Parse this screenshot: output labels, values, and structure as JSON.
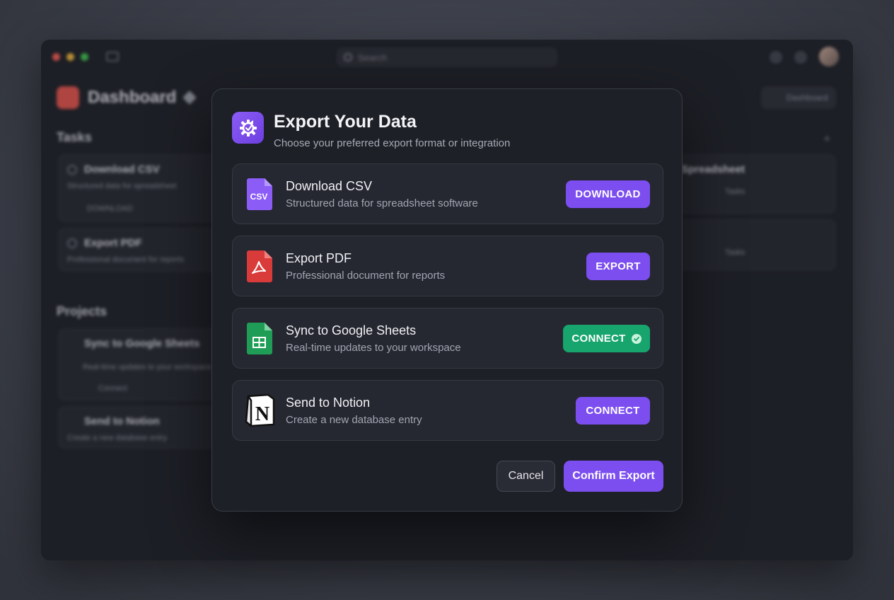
{
  "background": {
    "search_placeholder": "Search",
    "dashboard_title": "Dashboard",
    "tasks_heading": "Tasks",
    "projects_heading": "Projects",
    "header_pill_label": "Dashboard",
    "task_cards": [
      {
        "title": "Download CSV",
        "desc": "Structured data for spreadsheet",
        "meta": "DOWNLOAD"
      },
      {
        "title": "Export PDF",
        "desc": "Professional document for reports"
      }
    ],
    "project_cards": [
      {
        "title": "Sync to Google Sheets",
        "desc": "Real-time updates to your workspace",
        "meta": "Connect"
      },
      {
        "title": "Send to Notion",
        "desc": "Create a new database entry"
      }
    ],
    "right_cards": [
      {
        "title": "Spreadsheet",
        "meta": "Tasks"
      },
      {
        "title": "",
        "meta": "Tasks"
      }
    ]
  },
  "modal": {
    "title": "Export Your Data",
    "subtitle": "Choose your preferred export format or integration",
    "options": [
      {
        "title": "Download CSV",
        "desc": "Structured data for spreadsheet software",
        "button": "DOWNLOAD",
        "icon": "csv-file-icon",
        "icon_text": "CSV"
      },
      {
        "title": "Export PDF",
        "desc": "Professional document for reports",
        "button": "EXPORT",
        "icon": "pdf-file-icon"
      },
      {
        "title": "Sync to Google Sheets",
        "desc": "Real-time updates to your workspace",
        "button": "CONNECT",
        "icon": "google-sheets-icon",
        "connected": true
      },
      {
        "title": "Send to Notion",
        "desc": "Create a new database entry",
        "button": "CONNECT",
        "icon": "notion-icon",
        "icon_text": "N"
      }
    ],
    "cancel_label": "Cancel",
    "confirm_label": "Confirm Export"
  },
  "colors": {
    "accent": "#7c4ef0",
    "success": "#17a46d",
    "surface": "#1e2027",
    "card": "#262831"
  }
}
